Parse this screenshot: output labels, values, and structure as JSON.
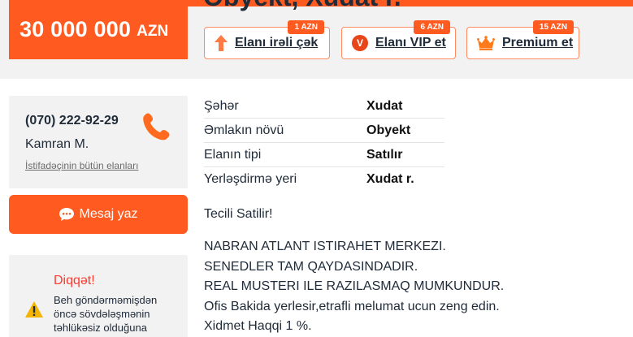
{
  "listing": {
    "title_partial": "Obyekt, Xudat r.",
    "price_value": "30 000 000",
    "price_currency": "AZN"
  },
  "promotions": [
    {
      "label": "Elanı irəli çək",
      "price": "1 AZN",
      "icon": "arrow-up-icon"
    },
    {
      "label": "Elanı VIP et",
      "price": "6 AZN",
      "icon": "vip-badge-icon",
      "icon_text": "V"
    },
    {
      "label": "Premium et",
      "price": "15 AZN",
      "icon": "crown-icon"
    }
  ],
  "contact": {
    "phone": "(070) 222-92-29",
    "name": "Kamran M.",
    "all_ads_link": "İstifadəçinin bütün elanları",
    "message_button": "Mesaj yaz"
  },
  "warning": {
    "title": "Diqqət!",
    "lines": [
      "Beh göndərməmişdən",
      "öncə sövdələşmənin",
      "təhlükəsiz olduğuna"
    ]
  },
  "properties": [
    {
      "label": "Şəhər",
      "value": "Xudat"
    },
    {
      "label": "Əmlakın növü",
      "value": "Obyekt"
    },
    {
      "label": "Elanın tipi",
      "value": "Satılır"
    },
    {
      "label": "Yerləşdirmə yeri",
      "value": "Xudat r."
    }
  ],
  "description": {
    "first": "Tecili Satilir!",
    "lines": [
      "NABRAN ATLANT ISTIRAHET MERKEZI.",
      "SENEDLER TAM QAYDASINDADIR.",
      "REAL MUSTERI ILE RAZILASMAQ MUMKUNDUR.",
      "Ofis Bakida yerlesir,etrafli melumat ucun zeng edin.",
      "Xidmet Haqqi 1 %."
    ]
  },
  "colors": {
    "accent": "#ff5a1f",
    "panel": "#f2f2f2",
    "warning_title": "#ff3b30",
    "warning_icon": "#f5b400"
  }
}
